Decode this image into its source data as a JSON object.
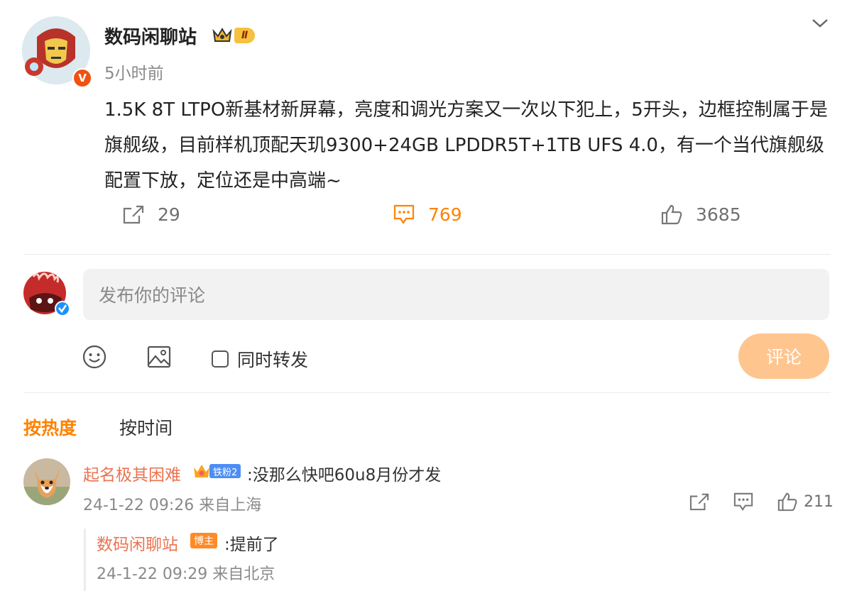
{
  "post": {
    "author": "数码闲聊站",
    "level_badge": "Ⅱ",
    "time": "5小时前",
    "verified_mark": "V",
    "text": "1.5K 8T LTPO新基材新屏幕，亮度和调光方案又一次以下犯上，5开头，边框控制属于是旗舰级，目前样机顶配天玑9300+24GB LPDDR5T+1TB UFS 4.0，有一个当代旗舰级配置下放，定位还是中高端~",
    "repost_count": "29",
    "comment_count": "769",
    "like_count": "3685"
  },
  "composer": {
    "placeholder": "发布你的评论",
    "repost_label": "同时转发",
    "submit_label": "评论"
  },
  "sort_tabs": {
    "hot": "按热度",
    "time": "按时间"
  },
  "comments": [
    {
      "author": "起名极其困难",
      "badge": "铁粉2",
      "text": ":没那么快吧60u8月份才发",
      "meta": "24-1-22 09:26 来自上海",
      "like_count": "211",
      "replies": [
        {
          "author": "数码闲聊站",
          "badge": "博主",
          "text": ":提前了",
          "meta": "24-1-22 09:29 来自北京"
        }
      ]
    }
  ],
  "colors": {
    "accent": "#ff8200",
    "username": "#eb7350",
    "submit_disabled": "#ffc58f"
  }
}
